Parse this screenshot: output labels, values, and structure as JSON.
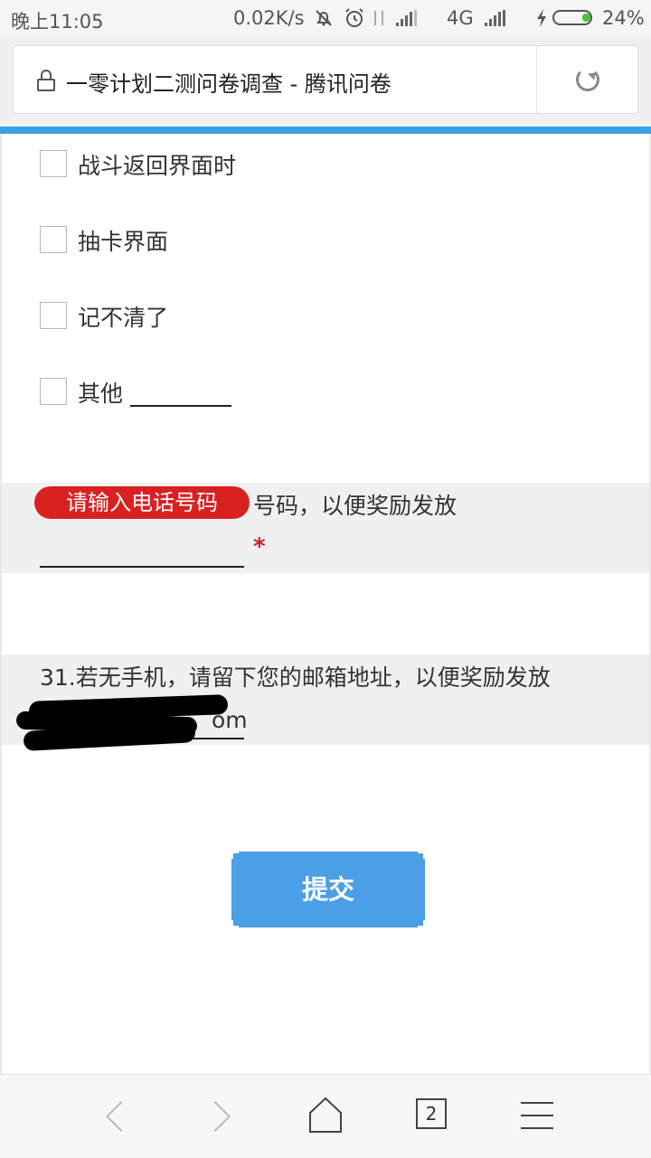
{
  "status_bar": {
    "time": "晚上11:05",
    "net_speed": "0.02K/s",
    "network": "4G",
    "battery": "24%",
    "icons": [
      "bell-off-icon",
      "alarm-icon",
      "data-arrows-icon",
      "signal-icon",
      "signal-icon",
      "charging-icon",
      "battery-icon"
    ]
  },
  "browser": {
    "page_title": "一零计划二测问卷调查 - 腾讯问卷",
    "tab_count": "2",
    "progress_color": "#3aa0e8"
  },
  "options": [
    {
      "label": "战斗返回界面时"
    },
    {
      "label": "抽卡界面"
    },
    {
      "label": "记不清了"
    },
    {
      "label": "其他"
    }
  ],
  "questions": {
    "phone": {
      "text": "号码，以便奖励发放",
      "required_mark": "*",
      "tooltip": "请输入电话号码"
    },
    "email": {
      "text": "31.若无手机，请留下您的邮箱地址，以便奖励发放",
      "value_visible": "om"
    }
  },
  "submit_label": "提交",
  "colors": {
    "accent": "#4a9fe6",
    "error": "#d92121",
    "band": "#f0f0f0"
  }
}
